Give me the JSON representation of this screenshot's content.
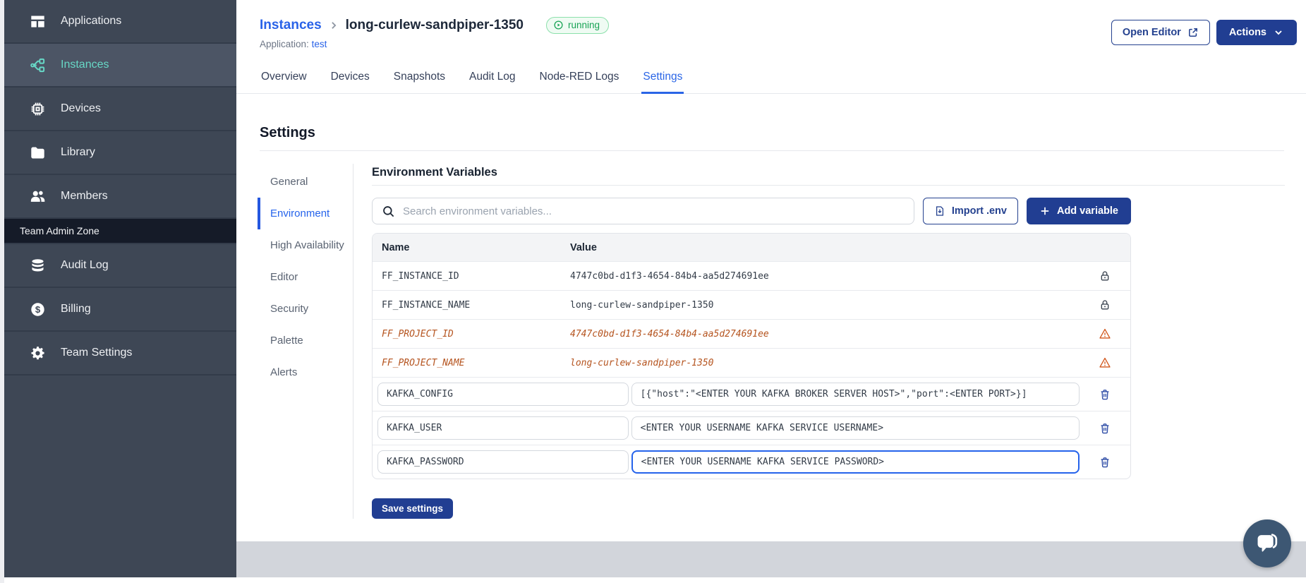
{
  "colors": {
    "sidebar_bg": "#3e4755",
    "sidebar_active_teal": "#67d8c6",
    "primary_navy": "#213e92",
    "accent_blue": "#2563eb",
    "running_green": "#18a355",
    "deprecated_orange": "#b5541f",
    "footer_gray": "#d2d5db"
  },
  "sidebar": {
    "items": [
      {
        "label": "Applications",
        "icon": "applications-icon"
      },
      {
        "label": "Instances",
        "icon": "instances-icon"
      },
      {
        "label": "Devices",
        "icon": "devices-icon"
      },
      {
        "label": "Library",
        "icon": "library-icon"
      },
      {
        "label": "Members",
        "icon": "members-icon"
      }
    ],
    "section_label": "Team Admin Zone",
    "admin_items": [
      {
        "label": "Audit Log",
        "icon": "database-icon"
      },
      {
        "label": "Billing",
        "icon": "billing-icon"
      },
      {
        "label": "Team Settings",
        "icon": "gear-icon"
      }
    ]
  },
  "header": {
    "breadcrumb_parent": "Instances",
    "breadcrumb_current": "long-curlew-sandpiper-1350",
    "status": "running",
    "application_label": "Application:",
    "application_name": "test",
    "open_editor": "Open Editor",
    "actions": "Actions"
  },
  "tabs": [
    {
      "label": "Overview"
    },
    {
      "label": "Devices"
    },
    {
      "label": "Snapshots"
    },
    {
      "label": "Audit Log"
    },
    {
      "label": "Node-RED Logs"
    },
    {
      "label": "Settings",
      "active": true
    }
  ],
  "settings": {
    "title": "Settings",
    "nav": [
      {
        "label": "General"
      },
      {
        "label": "Environment",
        "active": true
      },
      {
        "label": "High Availability"
      },
      {
        "label": "Editor"
      },
      {
        "label": "Security"
      },
      {
        "label": "Palette"
      },
      {
        "label": "Alerts"
      }
    ],
    "env": {
      "title": "Environment Variables",
      "search_placeholder": "Search environment variables...",
      "import_button": "Import .env",
      "add_button": "Add variable",
      "table_headers": [
        "Name",
        "Value"
      ],
      "rows": [
        {
          "name": "FF_INSTANCE_ID",
          "value": "4747c0bd-d1f3-4654-84b4-aa5d274691ee",
          "state": "locked"
        },
        {
          "name": "FF_INSTANCE_NAME",
          "value": "long-curlew-sandpiper-1350",
          "state": "locked"
        },
        {
          "name": "FF_PROJECT_ID",
          "value": "4747c0bd-d1f3-4654-84b4-aa5d274691ee",
          "state": "deprecated"
        },
        {
          "name": "FF_PROJECT_NAME",
          "value": "long-curlew-sandpiper-1350",
          "state": "deprecated"
        },
        {
          "name": "KAFKA_CONFIG",
          "value": "[{\"host\":\"<ENTER YOUR KAFKA BROKER SERVER HOST>\",\"port\":<ENTER PORT>}]",
          "state": "editable"
        },
        {
          "name": "KAFKA_USER",
          "value": "<ENTER YOUR USERNAME KAFKA SERVICE USERNAME>",
          "state": "editable"
        },
        {
          "name": "KAFKA_PASSWORD",
          "value": "<ENTER YOUR USERNAME KAFKA SERVICE PASSWORD>",
          "state": "editable",
          "focused": true
        }
      ],
      "save_button": "Save settings"
    }
  }
}
